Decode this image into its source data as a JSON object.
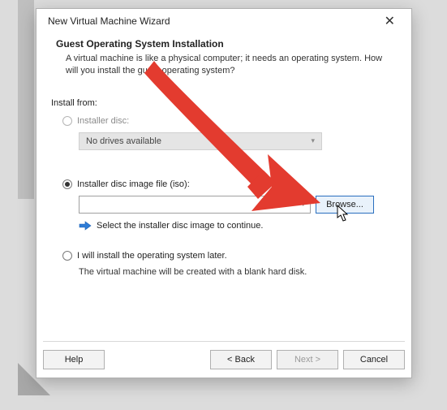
{
  "titlebar": {
    "title": "New Virtual Machine Wizard"
  },
  "header": {
    "heading": "Guest Operating System Installation",
    "description": "A virtual machine is like a physical computer; it needs an operating system. How will you install the guest operating system?"
  },
  "install_from_label": "Install from:",
  "options": {
    "disc": {
      "label": "Installer disc:",
      "dropdown_text": "No drives available"
    },
    "iso": {
      "label": "Installer disc image file (iso):",
      "input_value": "",
      "browse_label": "Browse...",
      "hint": "Select the installer disc image to continue."
    },
    "later": {
      "label": "I will install the operating system later.",
      "description": "The virtual machine will be created with a blank hard disk."
    }
  },
  "buttons": {
    "help": "Help",
    "back": "< Back",
    "next": "Next >",
    "cancel": "Cancel"
  }
}
